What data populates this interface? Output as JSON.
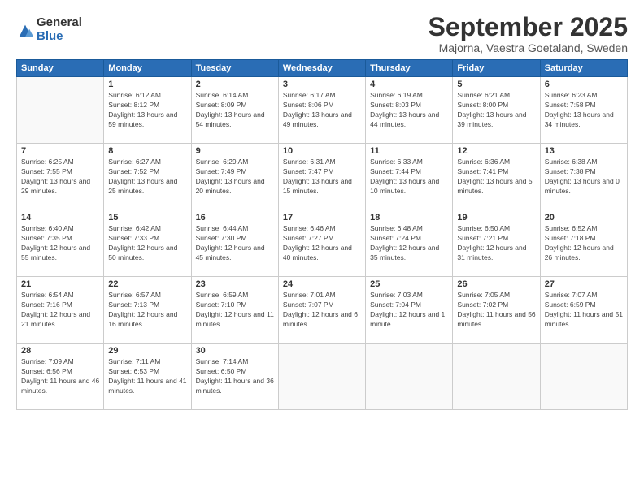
{
  "logo": {
    "general": "General",
    "blue": "Blue"
  },
  "title": "September 2025",
  "subtitle": "Majorna, Vaestra Goetaland, Sweden",
  "days_of_week": [
    "Sunday",
    "Monday",
    "Tuesday",
    "Wednesday",
    "Thursday",
    "Friday",
    "Saturday"
  ],
  "weeks": [
    [
      {
        "day": null
      },
      {
        "day": "1",
        "sunrise": "6:12 AM",
        "sunset": "8:12 PM",
        "daylight": "13 hours and 59 minutes."
      },
      {
        "day": "2",
        "sunrise": "6:14 AM",
        "sunset": "8:09 PM",
        "daylight": "13 hours and 54 minutes."
      },
      {
        "day": "3",
        "sunrise": "6:17 AM",
        "sunset": "8:06 PM",
        "daylight": "13 hours and 49 minutes."
      },
      {
        "day": "4",
        "sunrise": "6:19 AM",
        "sunset": "8:03 PM",
        "daylight": "13 hours and 44 minutes."
      },
      {
        "day": "5",
        "sunrise": "6:21 AM",
        "sunset": "8:00 PM",
        "daylight": "13 hours and 39 minutes."
      },
      {
        "day": "6",
        "sunrise": "6:23 AM",
        "sunset": "7:58 PM",
        "daylight": "13 hours and 34 minutes."
      }
    ],
    [
      {
        "day": "7",
        "sunrise": "6:25 AM",
        "sunset": "7:55 PM",
        "daylight": "13 hours and 29 minutes."
      },
      {
        "day": "8",
        "sunrise": "6:27 AM",
        "sunset": "7:52 PM",
        "daylight": "13 hours and 25 minutes."
      },
      {
        "day": "9",
        "sunrise": "6:29 AM",
        "sunset": "7:49 PM",
        "daylight": "13 hours and 20 minutes."
      },
      {
        "day": "10",
        "sunrise": "6:31 AM",
        "sunset": "7:47 PM",
        "daylight": "13 hours and 15 minutes."
      },
      {
        "day": "11",
        "sunrise": "6:33 AM",
        "sunset": "7:44 PM",
        "daylight": "13 hours and 10 minutes."
      },
      {
        "day": "12",
        "sunrise": "6:36 AM",
        "sunset": "7:41 PM",
        "daylight": "13 hours and 5 minutes."
      },
      {
        "day": "13",
        "sunrise": "6:38 AM",
        "sunset": "7:38 PM",
        "daylight": "13 hours and 0 minutes."
      }
    ],
    [
      {
        "day": "14",
        "sunrise": "6:40 AM",
        "sunset": "7:35 PM",
        "daylight": "12 hours and 55 minutes."
      },
      {
        "day": "15",
        "sunrise": "6:42 AM",
        "sunset": "7:33 PM",
        "daylight": "12 hours and 50 minutes."
      },
      {
        "day": "16",
        "sunrise": "6:44 AM",
        "sunset": "7:30 PM",
        "daylight": "12 hours and 45 minutes."
      },
      {
        "day": "17",
        "sunrise": "6:46 AM",
        "sunset": "7:27 PM",
        "daylight": "12 hours and 40 minutes."
      },
      {
        "day": "18",
        "sunrise": "6:48 AM",
        "sunset": "7:24 PM",
        "daylight": "12 hours and 35 minutes."
      },
      {
        "day": "19",
        "sunrise": "6:50 AM",
        "sunset": "7:21 PM",
        "daylight": "12 hours and 31 minutes."
      },
      {
        "day": "20",
        "sunrise": "6:52 AM",
        "sunset": "7:18 PM",
        "daylight": "12 hours and 26 minutes."
      }
    ],
    [
      {
        "day": "21",
        "sunrise": "6:54 AM",
        "sunset": "7:16 PM",
        "daylight": "12 hours and 21 minutes."
      },
      {
        "day": "22",
        "sunrise": "6:57 AM",
        "sunset": "7:13 PM",
        "daylight": "12 hours and 16 minutes."
      },
      {
        "day": "23",
        "sunrise": "6:59 AM",
        "sunset": "7:10 PM",
        "daylight": "12 hours and 11 minutes."
      },
      {
        "day": "24",
        "sunrise": "7:01 AM",
        "sunset": "7:07 PM",
        "daylight": "12 hours and 6 minutes."
      },
      {
        "day": "25",
        "sunrise": "7:03 AM",
        "sunset": "7:04 PM",
        "daylight": "12 hours and 1 minute."
      },
      {
        "day": "26",
        "sunrise": "7:05 AM",
        "sunset": "7:02 PM",
        "daylight": "11 hours and 56 minutes."
      },
      {
        "day": "27",
        "sunrise": "7:07 AM",
        "sunset": "6:59 PM",
        "daylight": "11 hours and 51 minutes."
      }
    ],
    [
      {
        "day": "28",
        "sunrise": "7:09 AM",
        "sunset": "6:56 PM",
        "daylight": "11 hours and 46 minutes."
      },
      {
        "day": "29",
        "sunrise": "7:11 AM",
        "sunset": "6:53 PM",
        "daylight": "11 hours and 41 minutes."
      },
      {
        "day": "30",
        "sunrise": "7:14 AM",
        "sunset": "6:50 PM",
        "daylight": "11 hours and 36 minutes."
      },
      {
        "day": null
      },
      {
        "day": null
      },
      {
        "day": null
      },
      {
        "day": null
      }
    ]
  ]
}
